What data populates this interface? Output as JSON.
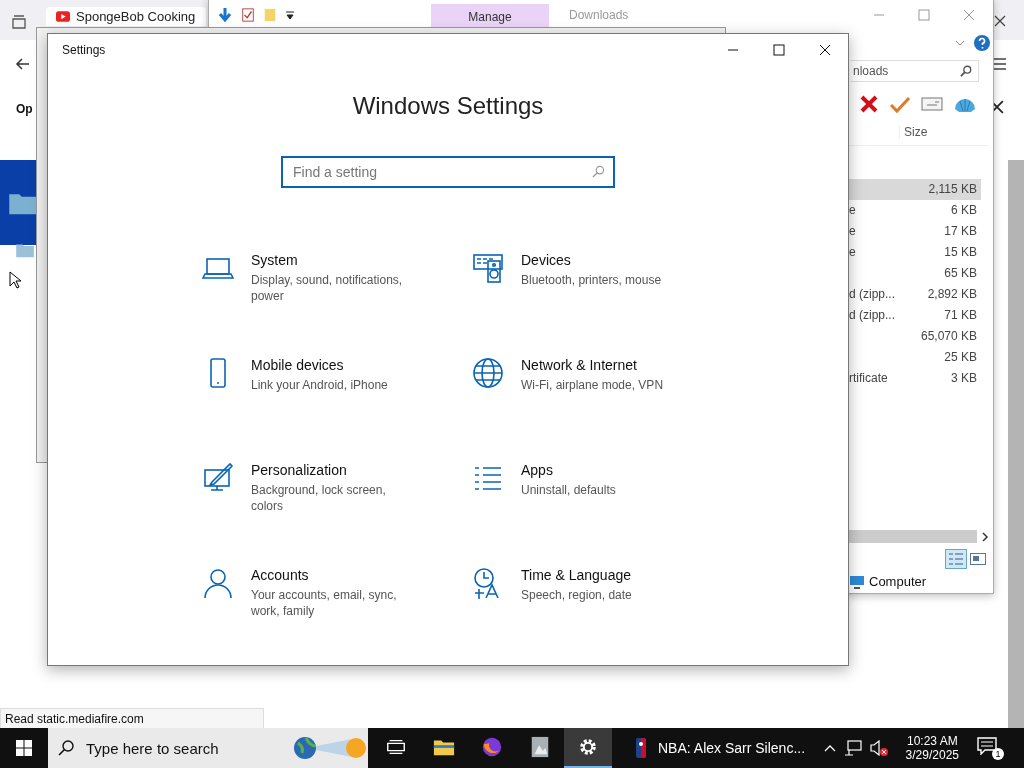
{
  "browser": {
    "tab_title": "SpongeBob Cooking",
    "page_text": "Op",
    "status": "Read static.mediafire.com"
  },
  "explorer": {
    "ribbon_tabs": [
      {
        "label": "Manage",
        "selected": true
      }
    ],
    "title": "Downloads",
    "search": {
      "value": "nloads"
    },
    "columns": [
      "Size"
    ],
    "rows": [
      {
        "size": "2,115 KB",
        "selected": true
      },
      {
        "type": "e",
        "size": "6 KB",
        "selected": false
      },
      {
        "type": "e",
        "size": "17 KB",
        "selected": false
      },
      {
        "type": "e",
        "size": "15 KB",
        "selected": false
      },
      {
        "size": "65 KB",
        "selected": false
      },
      {
        "type": "d (zipp...",
        "size": "2,892 KB",
        "selected": false
      },
      {
        "type": "d (zipp...",
        "size": "71 KB",
        "selected": false
      },
      {
        "size": "65,070 KB",
        "selected": false
      },
      {
        "size": "25 KB",
        "selected": false
      },
      {
        "type": "rtificate",
        "size": "3 KB",
        "selected": false
      }
    ],
    "status": "Computer"
  },
  "settings": {
    "title": "Settings",
    "heading": "Windows Settings",
    "search": {
      "placeholder": "Find a setting"
    },
    "categories": [
      {
        "kind": "laptop",
        "name": "System",
        "description": "Display, sound, notifications, power"
      },
      {
        "kind": "devices",
        "name": "Devices",
        "description": "Bluetooth, printers, mouse"
      },
      {
        "kind": "phone",
        "name": "Mobile devices",
        "description": "Link your Android, iPhone"
      },
      {
        "kind": "globe",
        "name": "Network & Internet",
        "description": "Wi-Fi, airplane mode, VPN"
      },
      {
        "kind": "paint",
        "name": "Personalization",
        "description": "Background, lock screen, colors"
      },
      {
        "kind": "apps",
        "name": "Apps",
        "description": "Uninstall, defaults"
      },
      {
        "kind": "person",
        "name": "Accounts",
        "description": "Your accounts, email, sync, work, family"
      },
      {
        "kind": "time",
        "name": "Time & Language",
        "description": "Speech, region, date"
      }
    ]
  },
  "taskbar": {
    "search": {
      "placeholder": "Type here to search"
    },
    "apps": [
      {
        "kind": "taskview",
        "selected": false
      },
      {
        "kind": "folder",
        "selected": false
      },
      {
        "kind": "firefox",
        "selected": false
      },
      {
        "kind": "photo",
        "selected": false
      },
      {
        "kind": "settings",
        "selected": true
      }
    ],
    "news": "NBA: Alex Sarr Silenc...",
    "time": "10:23 AM",
    "date": "3/29/2025",
    "notifications": "1"
  }
}
